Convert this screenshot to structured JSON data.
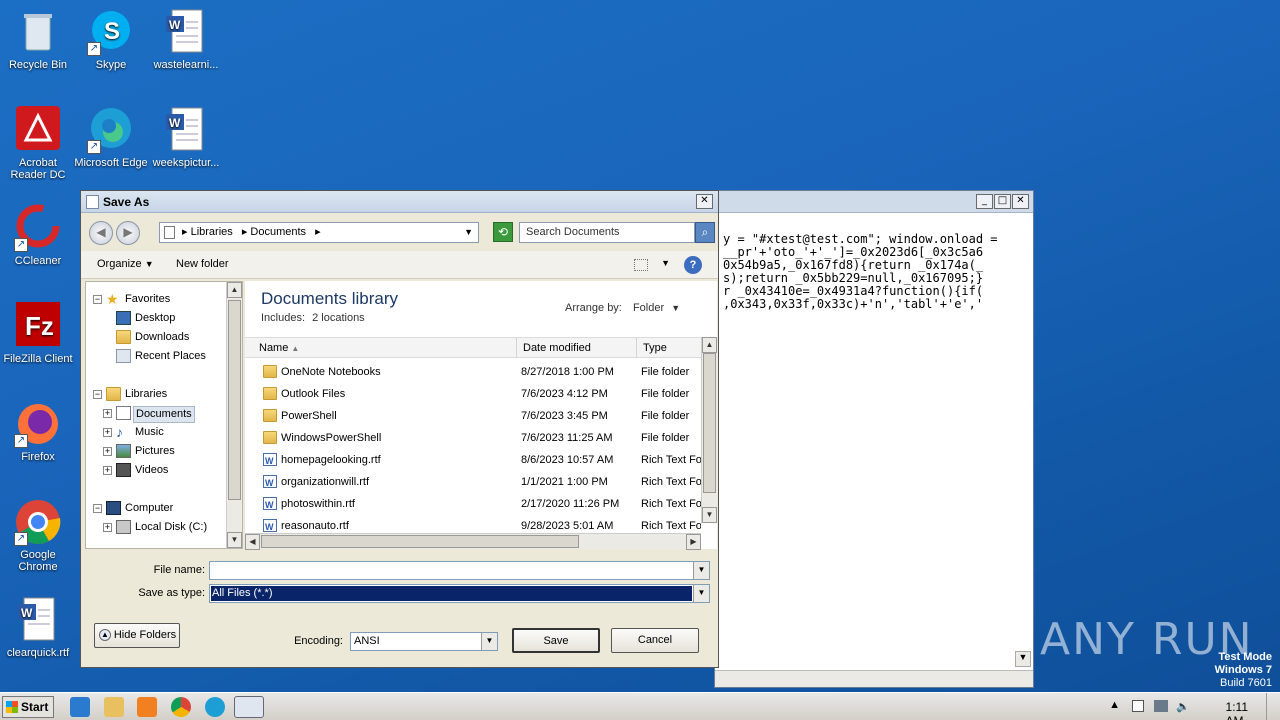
{
  "desktop": {
    "icons": [
      {
        "label": "Recycle Bin",
        "icon": "recycle-bin-icon"
      },
      {
        "label": "Skype",
        "icon": "skype-icon"
      },
      {
        "label": "wastelearni...",
        "icon": "word-doc-icon"
      },
      {
        "label": "Acrobat Reader DC",
        "icon": "acrobat-icon"
      },
      {
        "label": "Microsoft Edge",
        "icon": "edge-icon"
      },
      {
        "label": "weekspictur...",
        "icon": "word-doc-icon"
      },
      {
        "label": "CCleaner",
        "icon": "ccleaner-icon"
      },
      {
        "label": "FileZilla Client",
        "icon": "filezilla-icon"
      },
      {
        "label": "Firefox",
        "icon": "firefox-icon"
      },
      {
        "label": "Google Chrome",
        "icon": "chrome-icon"
      },
      {
        "label": "clearquick.rtf",
        "icon": "word-doc-icon"
      }
    ]
  },
  "bg_window": {
    "code_lines": [
      "y = \"#xtest@test.com\"; window.onload =",
      "__pr'+'oto_'+'_']=_0x2023d6[_0x3c5a6",
      "0x54b9a5,_0x167fd8){return _0x174a(_",
      "s);return _0x5bb229=null,_0x167095;}",
      "r _0x43410e=_0x4931a4?function(){if(",
      ",0x343,0x33f,0x33c)+'n','tabl'+'e','"
    ]
  },
  "dialog": {
    "title": "Save As",
    "address": {
      "crumbs": [
        "Libraries",
        "Documents"
      ],
      "separator": "▸"
    },
    "search_placeholder": "Search Documents",
    "toolbar": {
      "organize": "Organize",
      "new_folder": "New folder",
      "help": "?"
    },
    "nav": {
      "favorites": "Favorites",
      "desktop": "Desktop",
      "downloads": "Downloads",
      "recent": "Recent Places",
      "libraries": "Libraries",
      "documents": "Documents",
      "music": "Music",
      "pictures": "Pictures",
      "videos": "Videos",
      "computer": "Computer",
      "local_disk": "Local Disk (C:)"
    },
    "library": {
      "title": "Documents library",
      "includes": "Includes:",
      "locations": "2 locations",
      "arrange_label": "Arrange by:",
      "arrange_value": "Folder"
    },
    "columns": {
      "name": "Name",
      "date": "Date modified",
      "type": "Type"
    },
    "files": [
      {
        "name": "OneNote Notebooks",
        "date": "8/27/2018 1:00 PM",
        "type": "File folder",
        "kind": "folder"
      },
      {
        "name": "Outlook Files",
        "date": "7/6/2023 4:12 PM",
        "type": "File folder",
        "kind": "folder"
      },
      {
        "name": "PowerShell",
        "date": "7/6/2023 3:45 PM",
        "type": "File folder",
        "kind": "folder"
      },
      {
        "name": "WindowsPowerShell",
        "date": "7/6/2023 11:25 AM",
        "type": "File folder",
        "kind": "folder"
      },
      {
        "name": "homepagelooking.rtf",
        "date": "8/6/2023 10:57 AM",
        "type": "Rich Text Fo",
        "kind": "rtf"
      },
      {
        "name": "organizationwill.rtf",
        "date": "1/1/2021 1:00 PM",
        "type": "Rich Text Fo",
        "kind": "rtf"
      },
      {
        "name": "photoswithin.rtf",
        "date": "2/17/2020 11:26 PM",
        "type": "Rich Text Fo",
        "kind": "rtf"
      },
      {
        "name": "reasonauto.rtf",
        "date": "9/28/2023 5:01 AM",
        "type": "Rich Text Fo",
        "kind": "rtf"
      }
    ],
    "form": {
      "filename_label": "File name:",
      "filename_value": "",
      "savetype_label": "Save as type:",
      "savetype_value": "All Files  (*.*)",
      "encoding_label": "Encoding:",
      "encoding_value": "ANSI",
      "hide_folders": "Hide Folders",
      "save": "Save",
      "cancel": "Cancel"
    }
  },
  "taskbar": {
    "start": "Start",
    "clock": "1:11 AM"
  },
  "watermark": {
    "line1": "Test Mode",
    "line2": "Windows 7",
    "line3": "Build 7601",
    "brand": "ANY RUN"
  }
}
